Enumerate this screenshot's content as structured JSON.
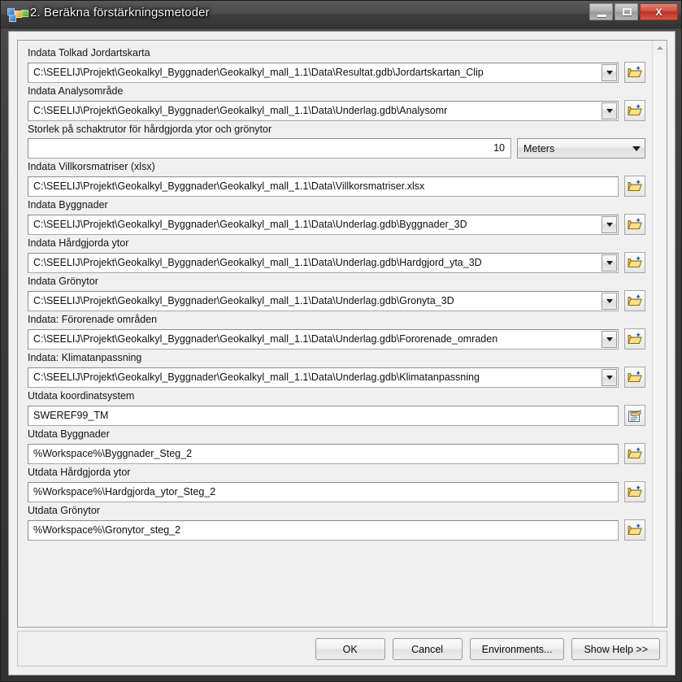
{
  "window": {
    "title": "2. Beräkna förstärkningsmetoder",
    "icon": "geoprocessing-model-icon",
    "controls": {
      "minimize": "minimize-button",
      "maximize": "maximize-button",
      "close_label": "X"
    }
  },
  "parameters": [
    {
      "label": "Indata Tolkad Jordartskarta",
      "value": "C:\\SEELIJ\\Projekt\\Geokalkyl_Byggnader\\Geokalkyl_mall_1.1\\Data\\Resultat.gdb\\Jordartskartan_Clip",
      "type": "combo-browse",
      "name": "indata-tolkad-jordartskarta"
    },
    {
      "label": "Indata Analysområde",
      "value": "C:\\SEELIJ\\Projekt\\Geokalkyl_Byggnader\\Geokalkyl_mall_1.1\\Data\\Underlag.gdb\\Analysomr",
      "type": "combo-browse",
      "name": "indata-analysomrade"
    },
    {
      "label": "Storlek på schaktrutor för hårdgjorda ytor och grönytor",
      "value": "10",
      "type": "number-units",
      "units_value": "Meters",
      "name": "storlek-schaktrutor"
    },
    {
      "label": "Indata Villkorsmatriser (xlsx)",
      "value": "C:\\SEELIJ\\Projekt\\Geokalkyl_Byggnader\\Geokalkyl_mall_1.1\\Data\\Villkorsmatriser.xlsx",
      "type": "text-browse",
      "name": "indata-villkorsmatriser"
    },
    {
      "label": "Indata Byggnader",
      "value": "C:\\SEELIJ\\Projekt\\Geokalkyl_Byggnader\\Geokalkyl_mall_1.1\\Data\\Underlag.gdb\\Byggnader_3D",
      "type": "combo-browse",
      "name": "indata-byggnader"
    },
    {
      "label": "Indata Hårdgjorda ytor",
      "value": "C:\\SEELIJ\\Projekt\\Geokalkyl_Byggnader\\Geokalkyl_mall_1.1\\Data\\Underlag.gdb\\Hardgjord_yta_3D",
      "type": "combo-browse",
      "name": "indata-hardgjorda-ytor"
    },
    {
      "label": "Indata Grönytor",
      "value": "C:\\SEELIJ\\Projekt\\Geokalkyl_Byggnader\\Geokalkyl_mall_1.1\\Data\\Underlag.gdb\\Gronyta_3D",
      "type": "combo-browse",
      "name": "indata-gronytor"
    },
    {
      "label": "Indata: Förorenade områden",
      "value": "C:\\SEELIJ\\Projekt\\Geokalkyl_Byggnader\\Geokalkyl_mall_1.1\\Data\\Underlag.gdb\\Fororenade_omraden",
      "type": "combo-browse",
      "name": "indata-fororenade-omraden"
    },
    {
      "label": "Indata: Klimatanpassning",
      "value": "C:\\SEELIJ\\Projekt\\Geokalkyl_Byggnader\\Geokalkyl_mall_1.1\\Data\\Underlag.gdb\\Klimatanpassning",
      "type": "combo-browse",
      "name": "indata-klimatanpassning"
    },
    {
      "label": "Utdata koordinatsystem",
      "value": "SWEREF99_TM",
      "type": "text-spatialref",
      "name": "utdata-koordinatsystem"
    },
    {
      "label": "Utdata Byggnader",
      "value": "%Workspace%\\Byggnader_Steg_2",
      "type": "text-browse",
      "name": "utdata-byggnader"
    },
    {
      "label": "Utdata Hårdgjorda ytor",
      "value": "%Workspace%\\Hardgjorda_ytor_Steg_2",
      "type": "text-browse",
      "name": "utdata-hardgjorda-ytor"
    },
    {
      "label": "Utdata Grönytor",
      "value": "%Workspace%\\Gronytor_steg_2",
      "type": "text-browse",
      "name": "utdata-gronytor"
    }
  ],
  "buttons": [
    {
      "label": "OK",
      "name": "ok-button"
    },
    {
      "label": "Cancel",
      "name": "cancel-button"
    },
    {
      "label": "Environments...",
      "name": "environments-button"
    },
    {
      "label": "Show Help >>",
      "name": "show-help-button"
    }
  ],
  "colors": {
    "titlebar": "#454545",
    "close_button": "#c0392b",
    "dialog_background": "#f0f0f0",
    "field_background": "#ffffff",
    "folder_icon": "#e8a317"
  }
}
